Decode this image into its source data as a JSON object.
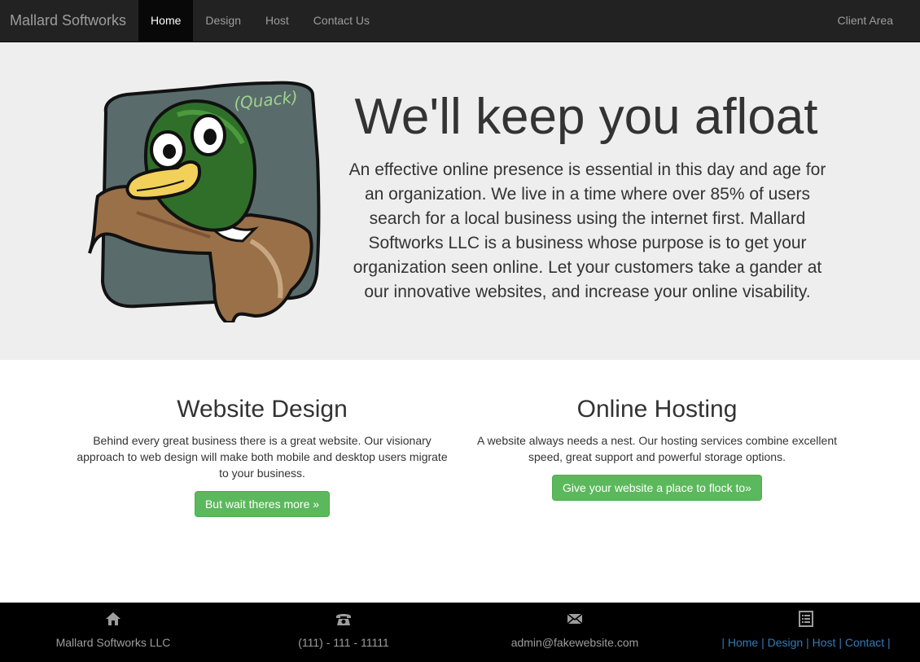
{
  "nav": {
    "brand": "Mallard Softworks",
    "items": [
      {
        "label": "Home",
        "active": true
      },
      {
        "label": "Design"
      },
      {
        "label": "Host"
      },
      {
        "label": "Contact Us"
      }
    ],
    "right_label": "Client Area"
  },
  "hero": {
    "duck_caption": "(Quack)",
    "title": "We'll keep you afloat",
    "text": "An effective online presence is essential in this day and age for an organization. We live in a time where over 85% of users search for a local business using the internet first. Mallard Softworks LLC is a business whose purpose is to get your organization seen online. Let your customers take a gander at our innovative websites, and increase your online visability."
  },
  "features": [
    {
      "title": "Website Design",
      "text": "Behind every great business there is a great website. Our visionary approach to web design will make both mobile and desktop users migrate to your business.",
      "button": "But wait theres more »"
    },
    {
      "title": "Online Hosting",
      "text": "A website always needs a nest. Our hosting services combine excellent speed, great support and powerful storage options.",
      "button": "Give your website a place to flock to»"
    }
  ],
  "footer": {
    "company": "Mallard Softworks LLC",
    "phone": "(111) - 111 - 11111",
    "email": "admin@fakewebsite.com",
    "links": [
      "Home",
      "Design",
      "Host",
      "Contact"
    ],
    "separator": "|",
    "icons": [
      "home-icon",
      "phone-icon",
      "envelope-icon",
      "list-icon"
    ]
  },
  "colors": {
    "navbar": "#222222",
    "jumbotron": "#eeeeee",
    "button": "#5cb85c",
    "footer": "#000000",
    "link": "#337ab7"
  }
}
